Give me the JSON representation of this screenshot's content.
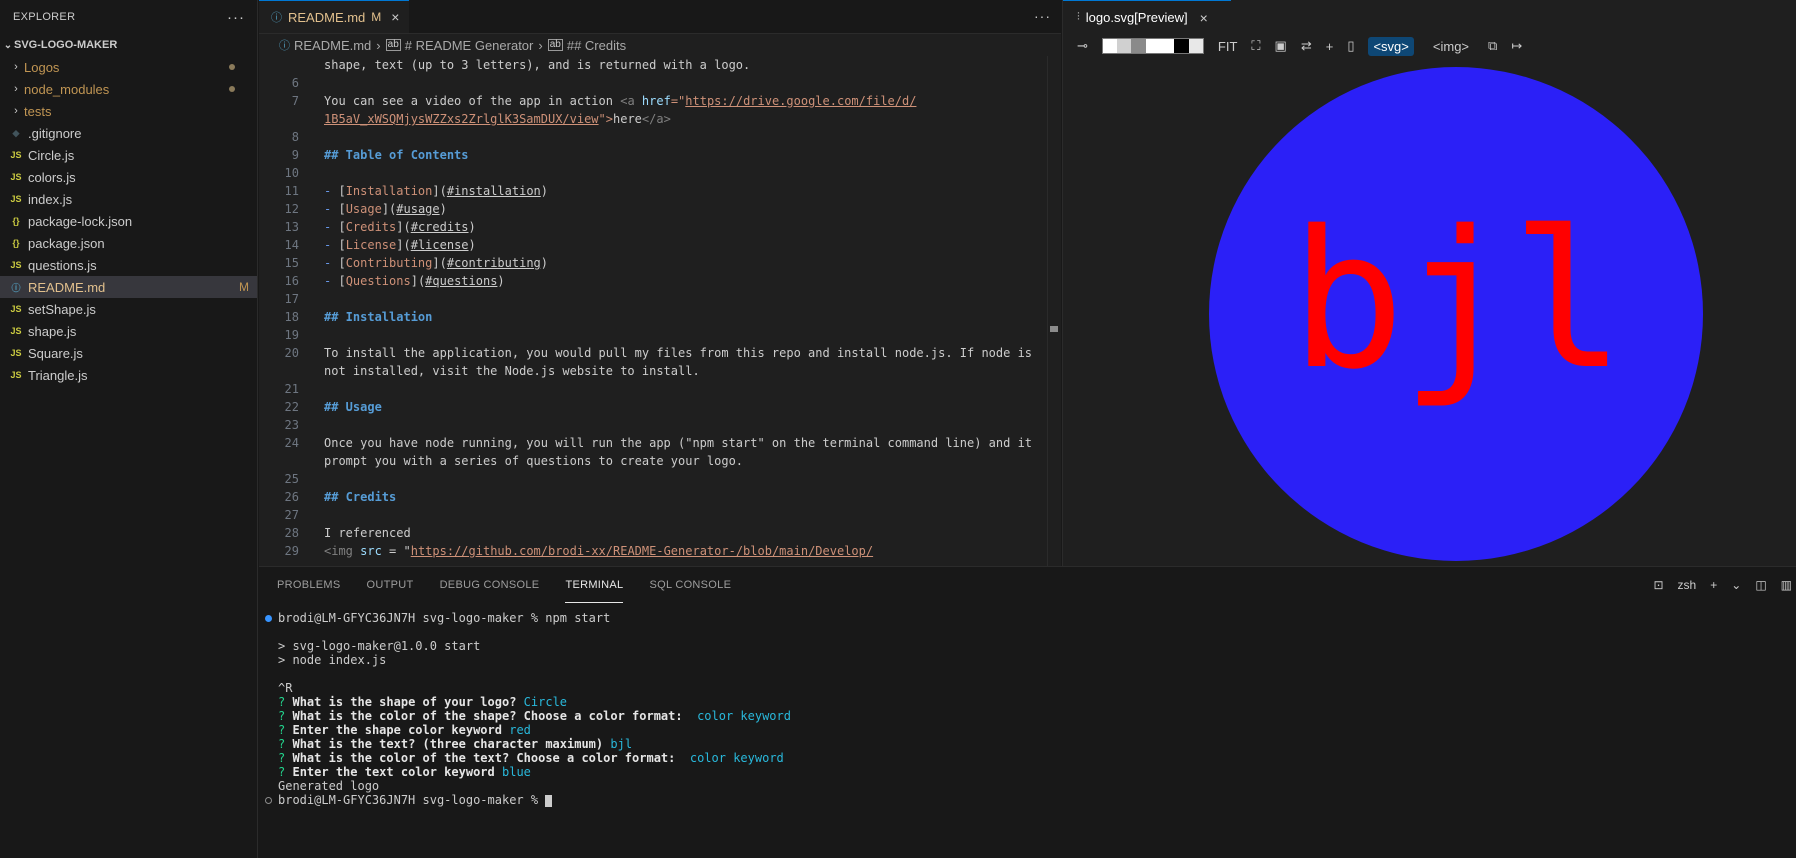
{
  "sidebar": {
    "title": "EXPLORER",
    "more": "···",
    "project": "SVG-LOGO-MAKER",
    "items": [
      {
        "label": "Logos",
        "type": "folder",
        "icon": "chevron-right-icon",
        "status": "dot"
      },
      {
        "label": "node_modules",
        "type": "folder",
        "icon": "chevron-right-icon",
        "status": "dot"
      },
      {
        "label": "tests",
        "type": "folder",
        "icon": "chevron-right-icon",
        "status": ""
      },
      {
        "label": ".gitignore",
        "type": "file",
        "icon": "git-icon",
        "status": ""
      },
      {
        "label": "Circle.js",
        "type": "file",
        "icon": "js-icon",
        "status": ""
      },
      {
        "label": "colors.js",
        "type": "file",
        "icon": "js-icon",
        "status": ""
      },
      {
        "label": "index.js",
        "type": "file",
        "icon": "js-icon",
        "status": ""
      },
      {
        "label": "package-lock.json",
        "type": "file",
        "icon": "json-icon",
        "status": ""
      },
      {
        "label": "package.json",
        "type": "file",
        "icon": "json-icon",
        "status": ""
      },
      {
        "label": "questions.js",
        "type": "file",
        "icon": "js-icon",
        "status": ""
      },
      {
        "label": "README.md",
        "type": "file",
        "icon": "info-icon",
        "status": "M"
      },
      {
        "label": "setShape.js",
        "type": "file",
        "icon": "js-icon",
        "status": ""
      },
      {
        "label": "shape.js",
        "type": "file",
        "icon": "js-icon",
        "status": ""
      },
      {
        "label": "Square.js",
        "type": "file",
        "icon": "js-icon",
        "status": ""
      },
      {
        "label": "Triangle.js",
        "type": "file",
        "icon": "js-icon",
        "status": ""
      }
    ]
  },
  "editor": {
    "tab": {
      "label": "README.md",
      "modified": "M"
    },
    "more": "···",
    "breadcrumb": [
      "README.md",
      "# README Generator",
      "## Credits"
    ],
    "cont_top": "shape, text (up to 3 letters), and is returned with a logo.",
    "lines": {
      "n6": "6",
      "n7": "7",
      "n8": "8",
      "n9": "9",
      "n10": "10",
      "n11": "11",
      "n12": "12",
      "n13": "13",
      "n14": "14",
      "n15": "15",
      "n16": "16",
      "n17": "17",
      "n18": "18",
      "n19": "19",
      "n20": "20",
      "n21": "21",
      "n22": "22",
      "n23": "23",
      "n24": "24",
      "n25": "25",
      "n26": "26",
      "n27": "27",
      "n28": "28",
      "n29": "29",
      "l7a": "You can see a video of the app in action ",
      "l7tag_open": "<a ",
      "l7attr": "href",
      "l7eq": "=\"",
      "l7url1": "https://drive.google.com/file/d/",
      "l7url2": "1B5aV_xWSQMjysWZZxs2ZrlglK3SamDUX/view",
      "l7close": "\">",
      "l7text": "here",
      "l7end": "</a>",
      "l9": "## Table of Contents",
      "toc": [
        {
          "text": "Installation",
          "link": "#installation"
        },
        {
          "text": "Usage",
          "link": "#usage"
        },
        {
          "text": "Credits",
          "link": "#credits"
        },
        {
          "text": "License",
          "link": "#license"
        },
        {
          "text": "Contributing",
          "link": "#contributing"
        },
        {
          "text": "Questions",
          "link": "#questions"
        }
      ],
      "l18": "## Installation",
      "l20a": "To install the application, you would pull my files from this repo and install node.js. If node is",
      "l20b": "not installed, visit the Node.js website to install.",
      "l22": "## Usage",
      "l24a": "Once you have node running, you will run the app (\"npm start\" on the terminal command line) and it",
      "l24b": "prompt you with a series of questions to create your logo.",
      "l26": "## Credits",
      "l28": "I referenced",
      "l29tag": "<img ",
      "l29attr": "src",
      "l29eq": " = \"",
      "l29url": "https://github.com/brodi-xx/README-Generator-/blob/main/Develop/"
    }
  },
  "preview": {
    "tab": "logo.svg[Preview]",
    "toolbar": {
      "fit": "FIT",
      "svg": "<svg>",
      "img": "<img>"
    },
    "logo": {
      "text": "bjl",
      "shape": "circle",
      "shape_color": "#2b20f7",
      "text_color": "#ff0000"
    }
  },
  "panel": {
    "tabs": [
      "PROBLEMS",
      "OUTPUT",
      "DEBUG CONSOLE",
      "TERMINAL",
      "SQL CONSOLE"
    ],
    "active_tab": "TERMINAL",
    "shell": "zsh",
    "terminal": {
      "prompt1": "brodi@LM-GFYC36JN7H svg-logo-maker % npm start",
      "out1": "> svg-logo-maker@1.0.0 start",
      "out2": "> node index.js",
      "out3": "^R",
      "q1": "What is the shape of your logo?",
      "a1": "Circle",
      "q2": "What is the color of the shape? Choose a color format: ",
      "a2": "color keyword",
      "q3": "Enter the shape color keyword",
      "a3": "red",
      "q4": "What is the text? (three character maximum)",
      "a4": "bjl",
      "q5": "What is the color of the text? Choose a color format: ",
      "a5": "color keyword",
      "q6": "Enter the text color keyword",
      "a6": "blue",
      "out4": "Generated logo",
      "prompt2": "brodi@LM-GFYC36JN7H svg-logo-maker % ",
      "qmark": "?"
    }
  }
}
